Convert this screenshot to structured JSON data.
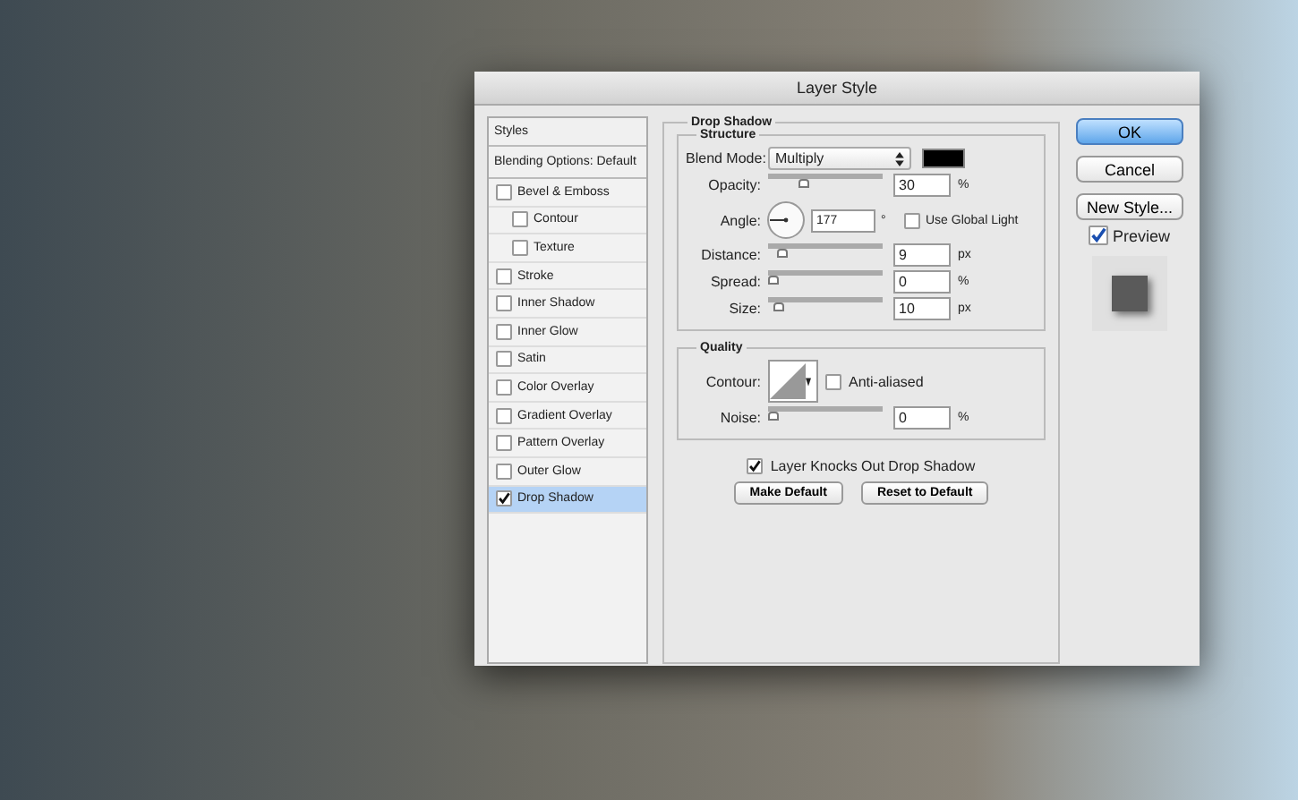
{
  "window": {
    "title": "Layer Style"
  },
  "styles_list": {
    "header": "Styles",
    "blending": "Blending Options: Default",
    "items": [
      {
        "label": "Bevel & Emboss",
        "checked": false,
        "selected": false,
        "children": [
          {
            "label": "Contour",
            "checked": false,
            "selected": false
          },
          {
            "label": "Texture",
            "checked": false,
            "selected": false
          }
        ]
      },
      {
        "label": "Stroke",
        "checked": false,
        "selected": false
      },
      {
        "label": "Inner Shadow",
        "checked": false,
        "selected": false
      },
      {
        "label": "Inner Glow",
        "checked": false,
        "selected": false
      },
      {
        "label": "Satin",
        "checked": false,
        "selected": false
      },
      {
        "label": "Color Overlay",
        "checked": false,
        "selected": false
      },
      {
        "label": "Gradient Overlay",
        "checked": false,
        "selected": false
      },
      {
        "label": "Pattern Overlay",
        "checked": false,
        "selected": false
      },
      {
        "label": "Outer Glow",
        "checked": false,
        "selected": false
      },
      {
        "label": "Drop Shadow",
        "checked": true,
        "selected": true
      }
    ]
  },
  "drop_shadow": {
    "title": "Drop Shadow",
    "structure": {
      "title": "Structure",
      "blend_mode": {
        "label": "Blend Mode:",
        "value": "Multiply"
      },
      "rows": [
        {
          "kind": "slider",
          "label": "Opacity:",
          "level": 0.3,
          "value": "30",
          "unit": "%"
        },
        {
          "kind": "angle",
          "label": "Angle:",
          "value": "177",
          "unit": "°",
          "global_light": {
            "label": "Use Global Light",
            "checked": false
          }
        },
        {
          "kind": "slider",
          "label": "Distance:",
          "level": 0.09,
          "value": "9",
          "unit": "px"
        },
        {
          "kind": "slider",
          "label": "Spread:",
          "level": 0,
          "value": "0",
          "unit": "%"
        },
        {
          "kind": "slider",
          "label": "Size:",
          "level": 0.05,
          "value": "10",
          "unit": "px"
        }
      ]
    },
    "quality": {
      "title": "Quality",
      "contour_label": "Contour:",
      "anti_aliased": {
        "label": "Anti-aliased",
        "checked": false
      },
      "noise": {
        "label": "Noise:",
        "level": 0,
        "value": "0",
        "unit": "%"
      }
    },
    "knockout": {
      "label": "Layer Knocks Out Drop Shadow",
      "checked": true
    },
    "buttons": [
      "Make Default",
      "Reset to Default"
    ]
  },
  "side": {
    "ok": "OK",
    "cancel": "Cancel",
    "new_style": "New Style...",
    "preview": {
      "label": "Preview",
      "checked": true
    }
  }
}
